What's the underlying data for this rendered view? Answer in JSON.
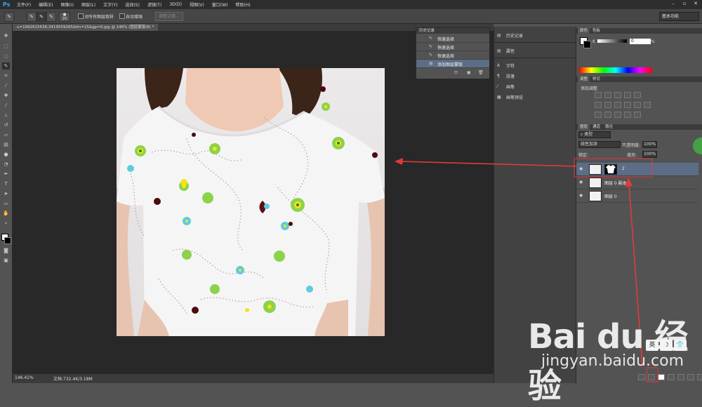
{
  "app": {
    "logo": "Ps"
  },
  "menu": [
    "文件(F)",
    "编辑(E)",
    "图像(I)",
    "图层(L)",
    "文字(Y)",
    "选择(S)",
    "滤镜(T)",
    "3D(D)",
    "视图(V)",
    "窗口(W)",
    "帮助(H)"
  ],
  "window_controls": [
    "–",
    "▫",
    "✕"
  ],
  "options_bar": {
    "brush_size": "20",
    "sample_all_layers": "对所有图层取样",
    "auto_enhance": "自动增强",
    "refine_edge": "调整边缘...",
    "workspace": "基本功能"
  },
  "document": {
    "tab_title": "u=1992615638,3419559265&fm=15&gp=0.jpg @ 146% (图层蒙版/8) *",
    "zoom": "146.41%",
    "doc_size": "文档:732.4K/3.18M"
  },
  "history_panel": {
    "title": "历史记录",
    "items": [
      {
        "label": "快速选择",
        "selected": false
      },
      {
        "label": "快速选择",
        "selected": false
      },
      {
        "label": "快速选择",
        "selected": false
      },
      {
        "label": "添加图层蒙版",
        "selected": true
      }
    ]
  },
  "dock": {
    "items": [
      "历史记录",
      "属性",
      "字符",
      "段落",
      "画笔",
      "画笔预设"
    ]
  },
  "color_panel": {
    "tabs": [
      "颜色",
      "色板"
    ],
    "channel": "K",
    "value": "0",
    "unit": "%"
  },
  "adjustments_panel": {
    "tabs": [
      "调整",
      "样式"
    ],
    "title": "添加调整"
  },
  "layers_panel": {
    "tabs": [
      "图层",
      "通道",
      "路径"
    ],
    "filter_kind": "类型",
    "blend_mode": "线性加深",
    "opacity_label": "不透明度:",
    "opacity_value": "100%",
    "lock_label": "锁定:",
    "fill_label": "填充:",
    "fill_value": "100%",
    "layers": [
      {
        "name": "2",
        "selected": true,
        "has_mask": true
      },
      {
        "name": "图层 0 副本",
        "selected": false,
        "has_mask": false
      },
      {
        "name": "图层 0",
        "selected": false,
        "has_mask": false
      }
    ]
  },
  "watermark": {
    "main": "Bai du 经验",
    "sub": "jingyan.baidu.com"
  },
  "ime": [
    "英",
    "☽",
    "👕"
  ],
  "colors": {
    "accent_red": "#e23a3a",
    "selection_blue": "#5c6d86",
    "ps_blue": "#31a8ff"
  }
}
